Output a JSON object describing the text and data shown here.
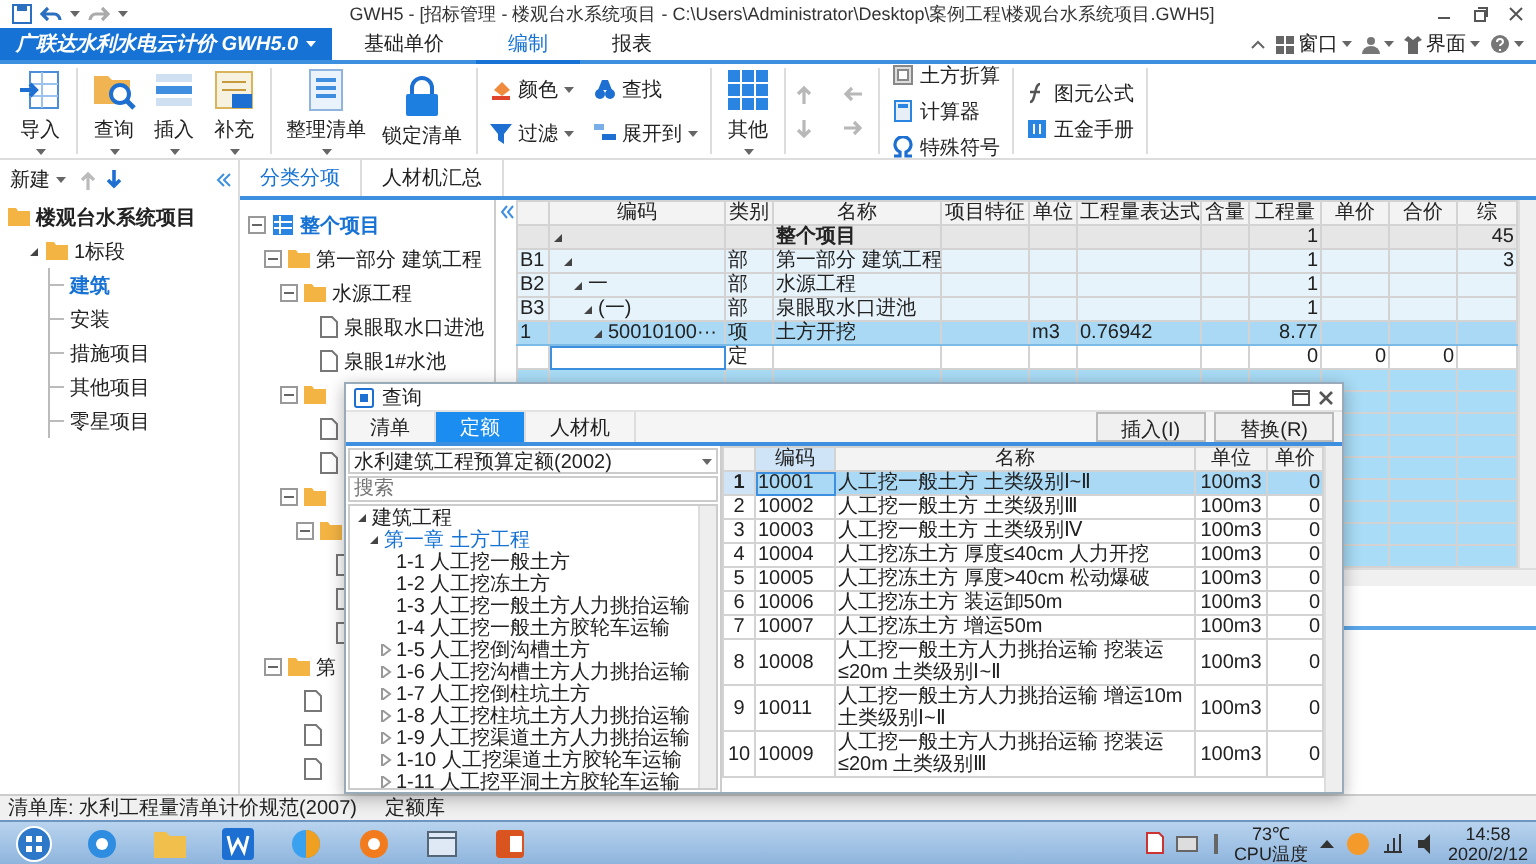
{
  "title_bar": {
    "title": "GWH5 - [招标管理 - 楼观台水系统项目 - C:\\Users\\Administrator\\Desktop\\案例工程\\楼观台水系统项目.GWH5]"
  },
  "app_menu": {
    "label": "广联达水利水电云计价 GWH5.0"
  },
  "ribbon_tabs": [
    {
      "label": "基础单价",
      "selected": false
    },
    {
      "label": "编制",
      "selected": true
    },
    {
      "label": "报表",
      "selected": false
    }
  ],
  "ribbon_right": [
    {
      "label": "窗口"
    },
    {
      "label": "界面"
    }
  ],
  "ribbon_groups": [
    {
      "kind": "large",
      "items": [
        {
          "label": "导入",
          "dropdown": true
        }
      ]
    },
    {
      "kind": "large",
      "items": [
        {
          "label": "查询",
          "dropdown": true
        },
        {
          "label": "插入",
          "dropdown": true
        },
        {
          "label": "补充",
          "dropdown": true
        }
      ]
    },
    {
      "kind": "large",
      "items": [
        {
          "label": "整理清单",
          "dropdown": true
        },
        {
          "label": "锁定清单",
          "dropdown": false
        }
      ]
    },
    {
      "kind": "grid",
      "items": [
        {
          "label": "颜色",
          "dropdown": true
        },
        {
          "label": "查找",
          "dropdown": false
        },
        {
          "label": "过滤",
          "dropdown": true
        },
        {
          "label": "展开到",
          "dropdown": true
        }
      ]
    },
    {
      "kind": "large",
      "items": [
        {
          "label": "其他",
          "dropdown": true
        }
      ]
    },
    {
      "kind": "arrows",
      "items": [
        {
          "disabled": true
        },
        {
          "disabled": true
        },
        {
          "disabled": true
        },
        {
          "disabled": true
        }
      ]
    },
    {
      "kind": "column",
      "items": [
        {
          "label": "土方折算"
        },
        {
          "label": "计算器"
        },
        {
          "label": "特殊符号"
        }
      ]
    },
    {
      "kind": "column",
      "items": [
        {
          "label": "图元公式"
        },
        {
          "label": "五金手册"
        }
      ]
    }
  ],
  "left_panel": {
    "new_button": "新建",
    "tree": [
      {
        "label": "楼观台水系统项目",
        "kind": "project",
        "selected": false,
        "children": [
          {
            "label": "1标段",
            "kind": "folder",
            "expanded": true,
            "selected": false,
            "children": [
              {
                "label": "建筑",
                "kind": "leaf",
                "selected": true
              },
              {
                "label": "安装",
                "kind": "leaf",
                "selected": false
              },
              {
                "label": "措施项目",
                "kind": "leaf",
                "selected": false
              },
              {
                "label": "其他项目",
                "kind": "leaf",
                "selected": false
              },
              {
                "label": "零星项目",
                "kind": "leaf",
                "selected": false
              }
            ]
          }
        ]
      }
    ]
  },
  "sub_tabs": [
    {
      "label": "分类分项",
      "selected": true
    },
    {
      "label": "人材机汇总",
      "selected": false
    }
  ],
  "section_tree": [
    {
      "label": "整个项目",
      "kind": "root",
      "expanded": true,
      "selected": true,
      "children": [
        {
          "label": "第一部分 建筑工程",
          "kind": "folder",
          "expanded": true,
          "selected": false,
          "children": [
            {
              "label": "水源工程",
              "kind": "folder",
              "expanded": true,
              "selected": false,
              "children": [
                {
                  "label": "泉眼取水口进池",
                  "kind": "doc",
                  "selected": false
                },
                {
                  "label": "泉眼1#水池",
                  "kind": "doc",
                  "selected": false
                }
              ]
            },
            {
              "kind": "folder",
              "expanded": true,
              "children": [
                {
                  "kind": "doc"
                },
                {
                  "kind": "doc"
                }
              ]
            },
            {
              "kind": "folder",
              "expanded": true,
              "children": [
                {
                  "kind": "folder",
                  "expanded": true,
                  "children": [
                    {
                      "kind": "doc"
                    },
                    {
                      "kind": "doc"
                    },
                    {
                      "kind": "doc"
                    }
                  ]
                }
              ]
            }
          ]
        },
        {
          "label": "第",
          "kind": "folder",
          "expanded": true,
          "selected": false,
          "children": [
            {
              "kind": "doc"
            },
            {
              "kind": "doc"
            },
            {
              "kind": "doc"
            }
          ]
        }
      ]
    }
  ],
  "main_table": {
    "columns": [
      "编码",
      "类别",
      "名称",
      "项目特征",
      "单位",
      "工程量表达式",
      "含量",
      "工程量",
      "单价",
      "合价",
      "综"
    ],
    "rows": [
      {
        "kind": "total",
        "expanded": true,
        "selected": false,
        "name": "整个项目",
        "quantity": "1",
        "composite": "45",
        "children": [
          {
            "kind": "section",
            "row_no": "B1",
            "expanded": true,
            "selected": false,
            "category": "部",
            "name": "第一部分 建筑工程",
            "quantity": "1",
            "composite": "3",
            "children": [
              {
                "kind": "section",
                "row_no": "B2",
                "expanded": true,
                "selected": false,
                "code": "一",
                "category": "部",
                "name": "水源工程",
                "quantity": "1",
                "children": [
                  {
                    "kind": "section",
                    "row_no": "B3",
                    "expanded": true,
                    "selected": false,
                    "code": "(一)",
                    "category": "部",
                    "name": "泉眼取水口进池",
                    "quantity": "1",
                    "children": [
                      {
                        "kind": "item",
                        "row_no": "1",
                        "expanded": true,
                        "selected": true,
                        "code": "50010100···",
                        "category": "项",
                        "name": "土方开挖",
                        "unit": "m3",
                        "expression": "0.76942",
                        "quantity": "8.77",
                        "children": [
                          {
                            "kind": "quota",
                            "expanded": false,
                            "selected": false,
                            "category": "定",
                            "quantity": "0",
                            "unit_price": "0",
                            "total_price": "0"
                          }
                        ]
                      }
                    ]
                  }
                ]
              }
            ]
          }
        ]
      }
    ]
  },
  "dialog": {
    "title": "查询",
    "tabs": [
      {
        "label": "清单",
        "selected": false
      },
      {
        "label": "定额",
        "selected": true
      },
      {
        "label": "人材机",
        "selected": false
      }
    ],
    "buttons": [
      "插入(I)",
      "替换(R)"
    ],
    "library": "水利建筑工程预算定额(2002)",
    "search": {
      "placeholder": "搜索"
    },
    "tree": [
      {
        "label": "建筑工程",
        "kind": "group",
        "expanded": true,
        "selected": false,
        "children": [
          {
            "label": "第一章 土方工程",
            "kind": "group",
            "expanded": true,
            "selected": true,
            "children": [
              {
                "label": "1-1 人工挖一般土方",
                "kind": "leaf",
                "selected": false
              },
              {
                "label": "1-2 人工挖冻土方",
                "kind": "leaf",
                "selected": false
              },
              {
                "label": "1-3 人工挖一般土方人力挑抬运输",
                "kind": "leaf",
                "selected": false
              },
              {
                "label": "1-4 人工挖一般土方胶轮车运输",
                "kind": "leaf",
                "selected": false
              },
              {
                "label": "1-5 人工挖倒沟槽土方",
                "kind": "group",
                "expanded": false,
                "selected": false
              },
              {
                "label": "1-6 人工挖沟槽土方人力挑抬运输",
                "kind": "group",
                "expanded": false,
                "selected": false
              },
              {
                "label": "1-7 人工挖倒柱坑土方",
                "kind": "group",
                "expanded": false,
                "selected": false
              },
              {
                "label": "1-8 人工挖柱坑土方人力挑抬运输",
                "kind": "group",
                "expanded": false,
                "selected": false
              },
              {
                "label": "1-9 人工挖渠道土方人力挑抬运输",
                "kind": "group",
                "expanded": false,
                "selected": false
              },
              {
                "label": "1-10 人工挖渠道土方胶轮车运输",
                "kind": "group",
                "expanded": false,
                "selected": false
              },
              {
                "label": "1-11 人工挖平洞土方胶轮车运输",
                "kind": "group",
                "expanded": false,
                "selected": false
              }
            ]
          }
        ]
      }
    ],
    "columns": [
      "编码",
      "名称",
      "单位",
      "单价"
    ],
    "rows": [
      {
        "no": "1",
        "code": "10001",
        "name": "人工挖一般土方 土类级别Ⅰ~Ⅱ",
        "unit": "100m3",
        "price": "0",
        "selected": true
      },
      {
        "no": "2",
        "code": "10002",
        "name": "人工挖一般土方 土类级别Ⅲ",
        "unit": "100m3",
        "price": "0",
        "selected": false
      },
      {
        "no": "3",
        "code": "10003",
        "name": "人工挖一般土方 土类级别Ⅳ",
        "unit": "100m3",
        "price": "0",
        "selected": false
      },
      {
        "no": "4",
        "code": "10004",
        "name": "人工挖冻土方 厚度≤40cm 人力开挖",
        "unit": "100m3",
        "price": "0",
        "selected": false
      },
      {
        "no": "5",
        "code": "10005",
        "name": "人工挖冻土方 厚度>40cm 松动爆破",
        "unit": "100m3",
        "price": "0",
        "selected": false
      },
      {
        "no": "6",
        "code": "10006",
        "name": "人工挖冻土方 装运卸50m",
        "unit": "100m3",
        "price": "0",
        "selected": false
      },
      {
        "no": "7",
        "code": "10007",
        "name": "人工挖冻土方 增运50m",
        "unit": "100m3",
        "price": "0",
        "selected": false
      },
      {
        "no": "8",
        "code": "10008",
        "name": "人工挖一般土方人力挑抬运输 挖装运≤20m 土类级别Ⅰ~Ⅱ",
        "unit": "100m3",
        "price": "0",
        "selected": false
      },
      {
        "no": "9",
        "code": "10011",
        "name": "人工挖一般土方人力挑抬运输 增运10m 土类级别Ⅰ~Ⅱ",
        "unit": "100m3",
        "price": "0",
        "selected": false
      },
      {
        "no": "10",
        "code": "10009",
        "name": "人工挖一般土方人力挑抬运输 挖装运≤20m 土类级别Ⅲ",
        "unit": "100m3",
        "price": "0",
        "selected": false
      }
    ]
  },
  "status_bar": [
    "清单库: 水利工程量清单计价规范(2007)",
    "定额库"
  ],
  "taskbar": {
    "temperature": "73℃",
    "temperature_label": "CPU温度",
    "time": "14:58",
    "date": "2020/2/12"
  }
}
